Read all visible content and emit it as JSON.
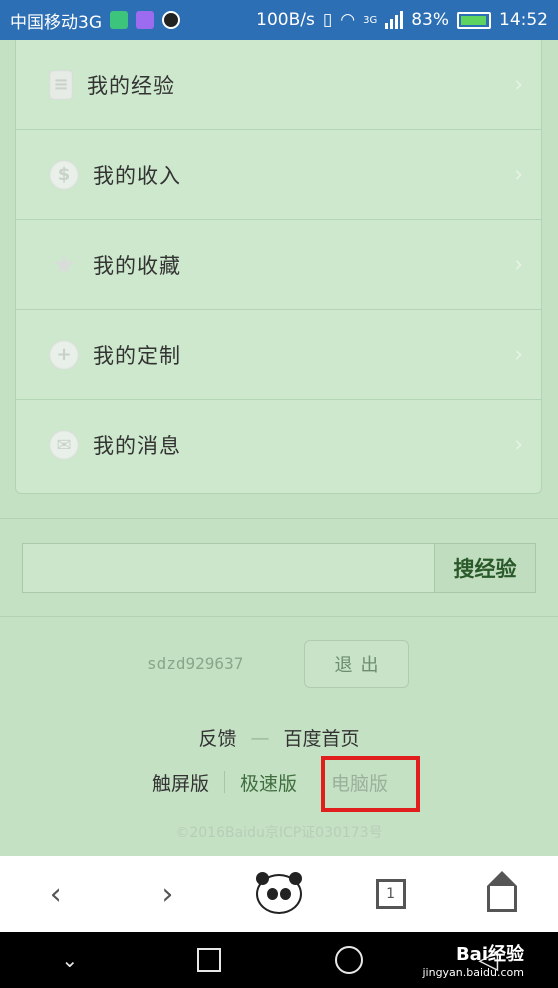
{
  "statusbar": {
    "carrier": "中国移动3G",
    "speed": "100B/s",
    "network": "3G",
    "battery": "83%",
    "time": "14:52"
  },
  "menu": {
    "items": [
      {
        "label": "我的经验",
        "icon": "document-icon"
      },
      {
        "label": "我的收入",
        "icon": "dollar-icon"
      },
      {
        "label": "我的收藏",
        "icon": "star-icon"
      },
      {
        "label": "我的定制",
        "icon": "plus-icon"
      },
      {
        "label": "我的消息",
        "icon": "mail-icon"
      }
    ]
  },
  "search": {
    "value": "",
    "button_label": "搜经验"
  },
  "account": {
    "username": "sdzd929637",
    "logout_label": "退出"
  },
  "footer": {
    "feedback": "反馈",
    "separator": "—",
    "baidu_home": "百度首页",
    "touch_version": "触屏版",
    "lite_version": "极速版",
    "pc_version": "电脑版",
    "copyright": "©2016Baidu京ICP证030173号"
  },
  "toolbar": {
    "back": "back-icon",
    "forward": "forward-icon",
    "panda": "panda-icon",
    "tab_count": "1",
    "home": "home-icon"
  },
  "navbar": {
    "collapse": "chevron-down-icon",
    "recent": "square-icon",
    "home": "circle-icon",
    "back": "triangle-back-icon"
  },
  "watermark": {
    "brand": "Bai经验",
    "url": "jingyan.baidu.com"
  },
  "colors": {
    "status_bar": "#2d6fb4",
    "page_bg": "#c4e1c4",
    "highlight": "#e01e1e"
  }
}
